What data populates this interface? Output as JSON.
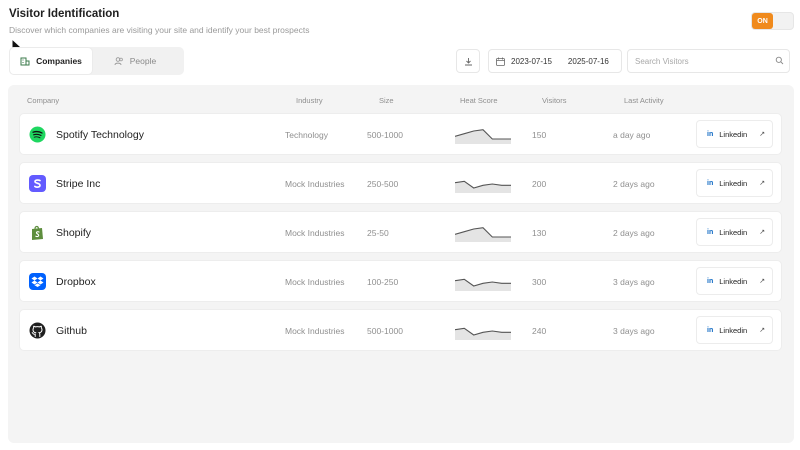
{
  "header": {
    "title": "Visitor Identification",
    "subtitle": "Discover which companies are visiting your site and identify your best prospects",
    "toggle_label": "ON"
  },
  "tabs": [
    {
      "label": "Companies",
      "icon": "building-icon",
      "active": true
    },
    {
      "label": "People",
      "icon": "people-icon",
      "active": false
    }
  ],
  "filters": {
    "start_date": "2023-07-15",
    "end_date": "2025-07-16",
    "search_placeholder": "Search Visitors"
  },
  "table": {
    "columns": [
      "Company",
      "Industry",
      "Size",
      "Heat Score",
      "Visitors",
      "Last Activity"
    ],
    "rows": [
      {
        "company": "Spotify Technology",
        "logo": "spotify-logo",
        "industry": "Technology",
        "size": "500-1000",
        "heat": [
          5,
          7,
          9,
          10,
          3,
          3,
          3
        ],
        "visitors": "150",
        "last_activity": "a day ago",
        "action": "Linkedin"
      },
      {
        "company": "Stripe Inc",
        "logo": "stripe-logo",
        "industry": "Mock Industries",
        "size": "250-500",
        "heat": [
          7,
          8,
          3,
          5,
          6,
          5,
          5
        ],
        "visitors": "200",
        "last_activity": "2 days ago",
        "action": "Linkedin"
      },
      {
        "company": "Shopify",
        "logo": "shopify-logo",
        "industry": "Mock Industries",
        "size": "25-50",
        "heat": [
          5,
          7,
          9,
          10,
          3,
          3,
          3
        ],
        "visitors": "130",
        "last_activity": "2 days ago",
        "action": "Linkedin"
      },
      {
        "company": "Dropbox",
        "logo": "dropbox-logo",
        "industry": "Mock Industries",
        "size": "100-250",
        "heat": [
          7,
          8,
          3,
          5,
          6,
          5,
          5
        ],
        "visitors": "300",
        "last_activity": "3 days ago",
        "action": "Linkedin"
      },
      {
        "company": "Github",
        "logo": "github-logo",
        "industry": "Mock Industries",
        "size": "500-1000",
        "heat": [
          7,
          8,
          3,
          5,
          6,
          5,
          5
        ],
        "visitors": "240",
        "last_activity": "3 days ago",
        "action": "Linkedin"
      }
    ]
  },
  "colors": {
    "accent": "#f08a1c",
    "spotify": "#1ed760",
    "stripe": "#635bff",
    "shopify": "#5e8e3e",
    "dropbox": "#0061fe",
    "github": "#1f1f1f",
    "linkedin": "#0a66c2"
  }
}
